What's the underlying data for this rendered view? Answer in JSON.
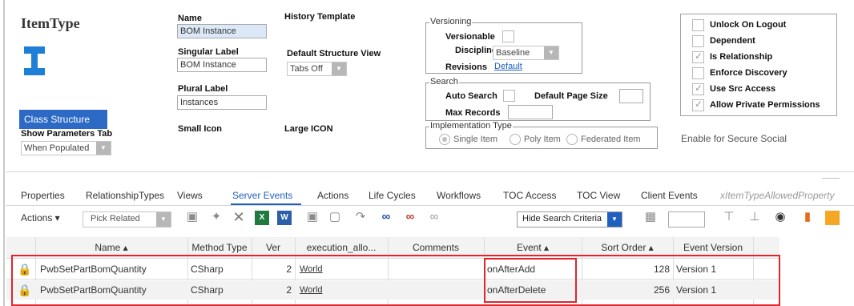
{
  "header": {
    "title": "ItemType",
    "class_structure_btn": "Class Structure",
    "show_params_label": "Show Parameters Tab",
    "show_params_value": "When Populated"
  },
  "form": {
    "name_label": "Name",
    "name_value": "BOM Instance",
    "history_label": "History Template",
    "singular_label": "Singular Label",
    "singular_value": "BOM Instance",
    "default_view_label": "Default Structure View",
    "default_view_value": "Tabs Off",
    "plural_label": "Plural Label",
    "plural_value": "Instances",
    "small_icon_label": "Small Icon",
    "large_icon_label": "Large ICON"
  },
  "versioning": {
    "legend": "Versioning",
    "versionable_label": "Versionable",
    "discipline_label": "Discipline",
    "discipline_value": "Baseline",
    "revisions_label": "Revisions",
    "revisions_value": "Default"
  },
  "search": {
    "legend": "Search",
    "auto_search_label": "Auto Search",
    "page_size_label": "Default Page Size",
    "max_records_label": "Max Records"
  },
  "implementation": {
    "legend": "Implementation Type",
    "options": [
      "Single Item",
      "Poly Item",
      "Federated Item"
    ]
  },
  "flags": [
    {
      "label": "Unlock On Logout",
      "checked": false
    },
    {
      "label": "Dependent",
      "checked": false
    },
    {
      "label": "Is Relationship",
      "checked": true
    },
    {
      "label": "Enforce Discovery",
      "checked": false
    },
    {
      "label": "Use Src Access",
      "checked": true
    },
    {
      "label": "Allow Private Permissions",
      "checked": true
    }
  ],
  "secure_social": "Enable for Secure Social",
  "tabs": [
    "Properties",
    "RelationshipTypes",
    "Views",
    "Server Events",
    "Actions",
    "Life Cycles",
    "Workflows",
    "TOC Access",
    "TOC View",
    "Client Events",
    "xItemTypeAllowedProperty"
  ],
  "active_tab": "Server Events",
  "toolbar": {
    "actions_label": "Actions ▾",
    "pick_related": "Pick Related",
    "hide_search": "Hide Search Criteria"
  },
  "grid": {
    "columns": [
      "Name ▴",
      "Method Type",
      "Ver",
      "execution_allo...",
      "Comments",
      "Event ▴",
      "Sort Order ▴",
      "Event Version"
    ],
    "rows": [
      {
        "name": "PwbSetPartBomQuantity",
        "method_type": "CSharp",
        "ver": "2",
        "exec": "World",
        "comments": "",
        "event": "onAfterAdd",
        "sort_order": "128",
        "event_version": "Version 1"
      },
      {
        "name": "PwbSetPartBomQuantity",
        "method_type": "CSharp",
        "ver": "2",
        "exec": "World",
        "comments": "",
        "event": "onAfterDelete",
        "sort_order": "256",
        "event_version": "Version 1"
      }
    ]
  },
  "colors": {
    "accent": "#1f5fbf",
    "highlight_border": "#e0262d",
    "button_blue": "#2d6ac6",
    "icon_blue": "#1e7fd6"
  }
}
